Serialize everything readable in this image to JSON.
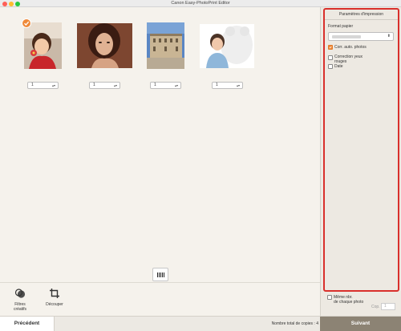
{
  "window": {
    "title": "Canon Easy-PhotoPrint Editor"
  },
  "photos": [
    {
      "copies": "1",
      "selected": true
    },
    {
      "copies": "1",
      "selected": false
    },
    {
      "copies": "1",
      "selected": false
    },
    {
      "copies": "1",
      "selected": false
    }
  ],
  "tools": {
    "filters_label_1": "Filtres",
    "filters_label_2": "créatifs",
    "crop_label": "Découper"
  },
  "sidebar": {
    "header": "Paramètres d'impression",
    "paper_label": "Format papier",
    "options": {
      "auto_photo": {
        "label": "Corr. auto. photos",
        "checked": true
      },
      "redeye_1": "Correction yeux",
      "redeye_2": "rouges",
      "date": "Date"
    },
    "same_copies_1": "Même nbr.",
    "same_copies_2": "de chaque photo",
    "copies_label": "Cop.",
    "copies_value": "1"
  },
  "footer": {
    "prev": "Précédent",
    "total": "Nombre total de copies : 4",
    "next": "Suivant"
  },
  "colors": {
    "accent": "#ef8a3a",
    "highlight": "#d9302c",
    "next_button": "#8c8374"
  }
}
